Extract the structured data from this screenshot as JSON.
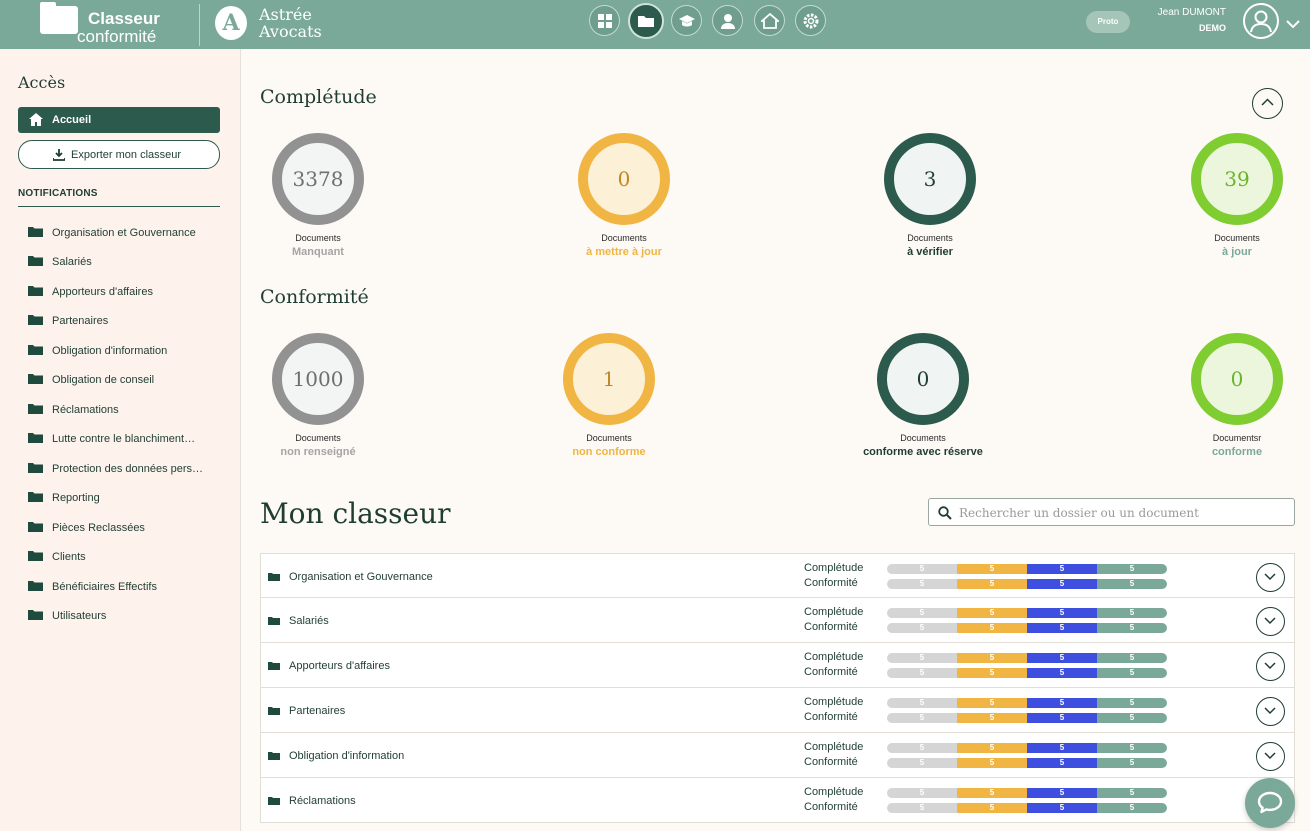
{
  "header": {
    "brand_line1": "Classeur",
    "brand_line2": "conformité",
    "firm_line1": "Astrée",
    "firm_line2": "Avocats",
    "firm_logo_letter": "A",
    "nav_icons": [
      "dashboard-icon",
      "folder-icon",
      "graduation-cap-icon",
      "user-icon",
      "house-icon",
      "gear-icon"
    ],
    "active_nav": "folder-icon",
    "proto_badge": "Proto",
    "user_name": "Jean DUMONT",
    "user_role": "DEMO"
  },
  "sidebar": {
    "title": "Accès",
    "home_label": "Accueil",
    "export_label": "Exporter mon classeur",
    "notifications_title": "NOTIFICATIONS",
    "items": [
      "Organisation et Gouvernance",
      "Salariés",
      "Apporteurs d'affaires",
      "Partenaires",
      "Obligation d'information",
      "Obligation de conseil",
      "Réclamations",
      "Lutte contre le blanchiment…",
      "Protection des données pers…",
      "Reporting",
      "Pièces Reclassées",
      "Clients",
      "Bénéficiaires Effectifs",
      "Utilisateurs"
    ]
  },
  "completude": {
    "title": "Complétude",
    "stats": [
      {
        "value": "3378",
        "label": "Documents",
        "status": "Manquant",
        "color": "grey"
      },
      {
        "value": "0",
        "label": "Documents",
        "status": "à mettre à jour",
        "color": "orange"
      },
      {
        "value": "3",
        "label": "Documents",
        "status": "à vérifier",
        "color": "dark"
      },
      {
        "value": "39",
        "label": "Documents",
        "status": "à jour",
        "color": "lime"
      }
    ]
  },
  "conformite": {
    "title": "Conformité",
    "stats": [
      {
        "value": "1000",
        "label": "Documents",
        "status": "non renseigné",
        "color": "grey"
      },
      {
        "value": "1",
        "label": "Documents",
        "status": "non conforme",
        "color": "orange"
      },
      {
        "value": "0",
        "label": "Documents",
        "status": "conforme avec réserve",
        "color": "dark"
      },
      {
        "value": "0",
        "label": "Documentsr",
        "status": "conforme",
        "color": "lime"
      }
    ]
  },
  "classeur": {
    "title": "Mon classeur",
    "search_placeholder": "Rechercher un dossier ou un document",
    "metric_labels": [
      "Complétude",
      "Conformité"
    ],
    "rows": [
      {
        "name": "Organisation et Gouvernance",
        "completude": [
          "5",
          "5",
          "5",
          "5"
        ],
        "conformite": [
          "5",
          "5",
          "5",
          "5"
        ]
      },
      {
        "name": "Salariés",
        "completude": [
          "5",
          "5",
          "5",
          "5"
        ],
        "conformite": [
          "5",
          "5",
          "5",
          "5"
        ]
      },
      {
        "name": "Apporteurs d'affaires",
        "completude": [
          "5",
          "5",
          "5",
          "5"
        ],
        "conformite": [
          "5",
          "5",
          "5",
          "5"
        ]
      },
      {
        "name": "Partenaires",
        "completude": [
          "5",
          "5",
          "5",
          "5"
        ],
        "conformite": [
          "5",
          "5",
          "5",
          "5"
        ]
      },
      {
        "name": "Obligation d'information",
        "completude": [
          "5",
          "5",
          "5",
          "5"
        ],
        "conformite": [
          "5",
          "5",
          "5",
          "5"
        ]
      },
      {
        "name": "Réclamations",
        "completude": [
          "5",
          "5",
          "5",
          "5"
        ],
        "conformite": [
          "5",
          "5",
          "5",
          "5"
        ]
      }
    ]
  },
  "colors": {
    "primary": "#2c5a4c",
    "sage": "#7ba999",
    "orange": "#f0b542",
    "lime": "#7fcd31",
    "grey": "#929292",
    "blue": "#3e4fe0"
  }
}
